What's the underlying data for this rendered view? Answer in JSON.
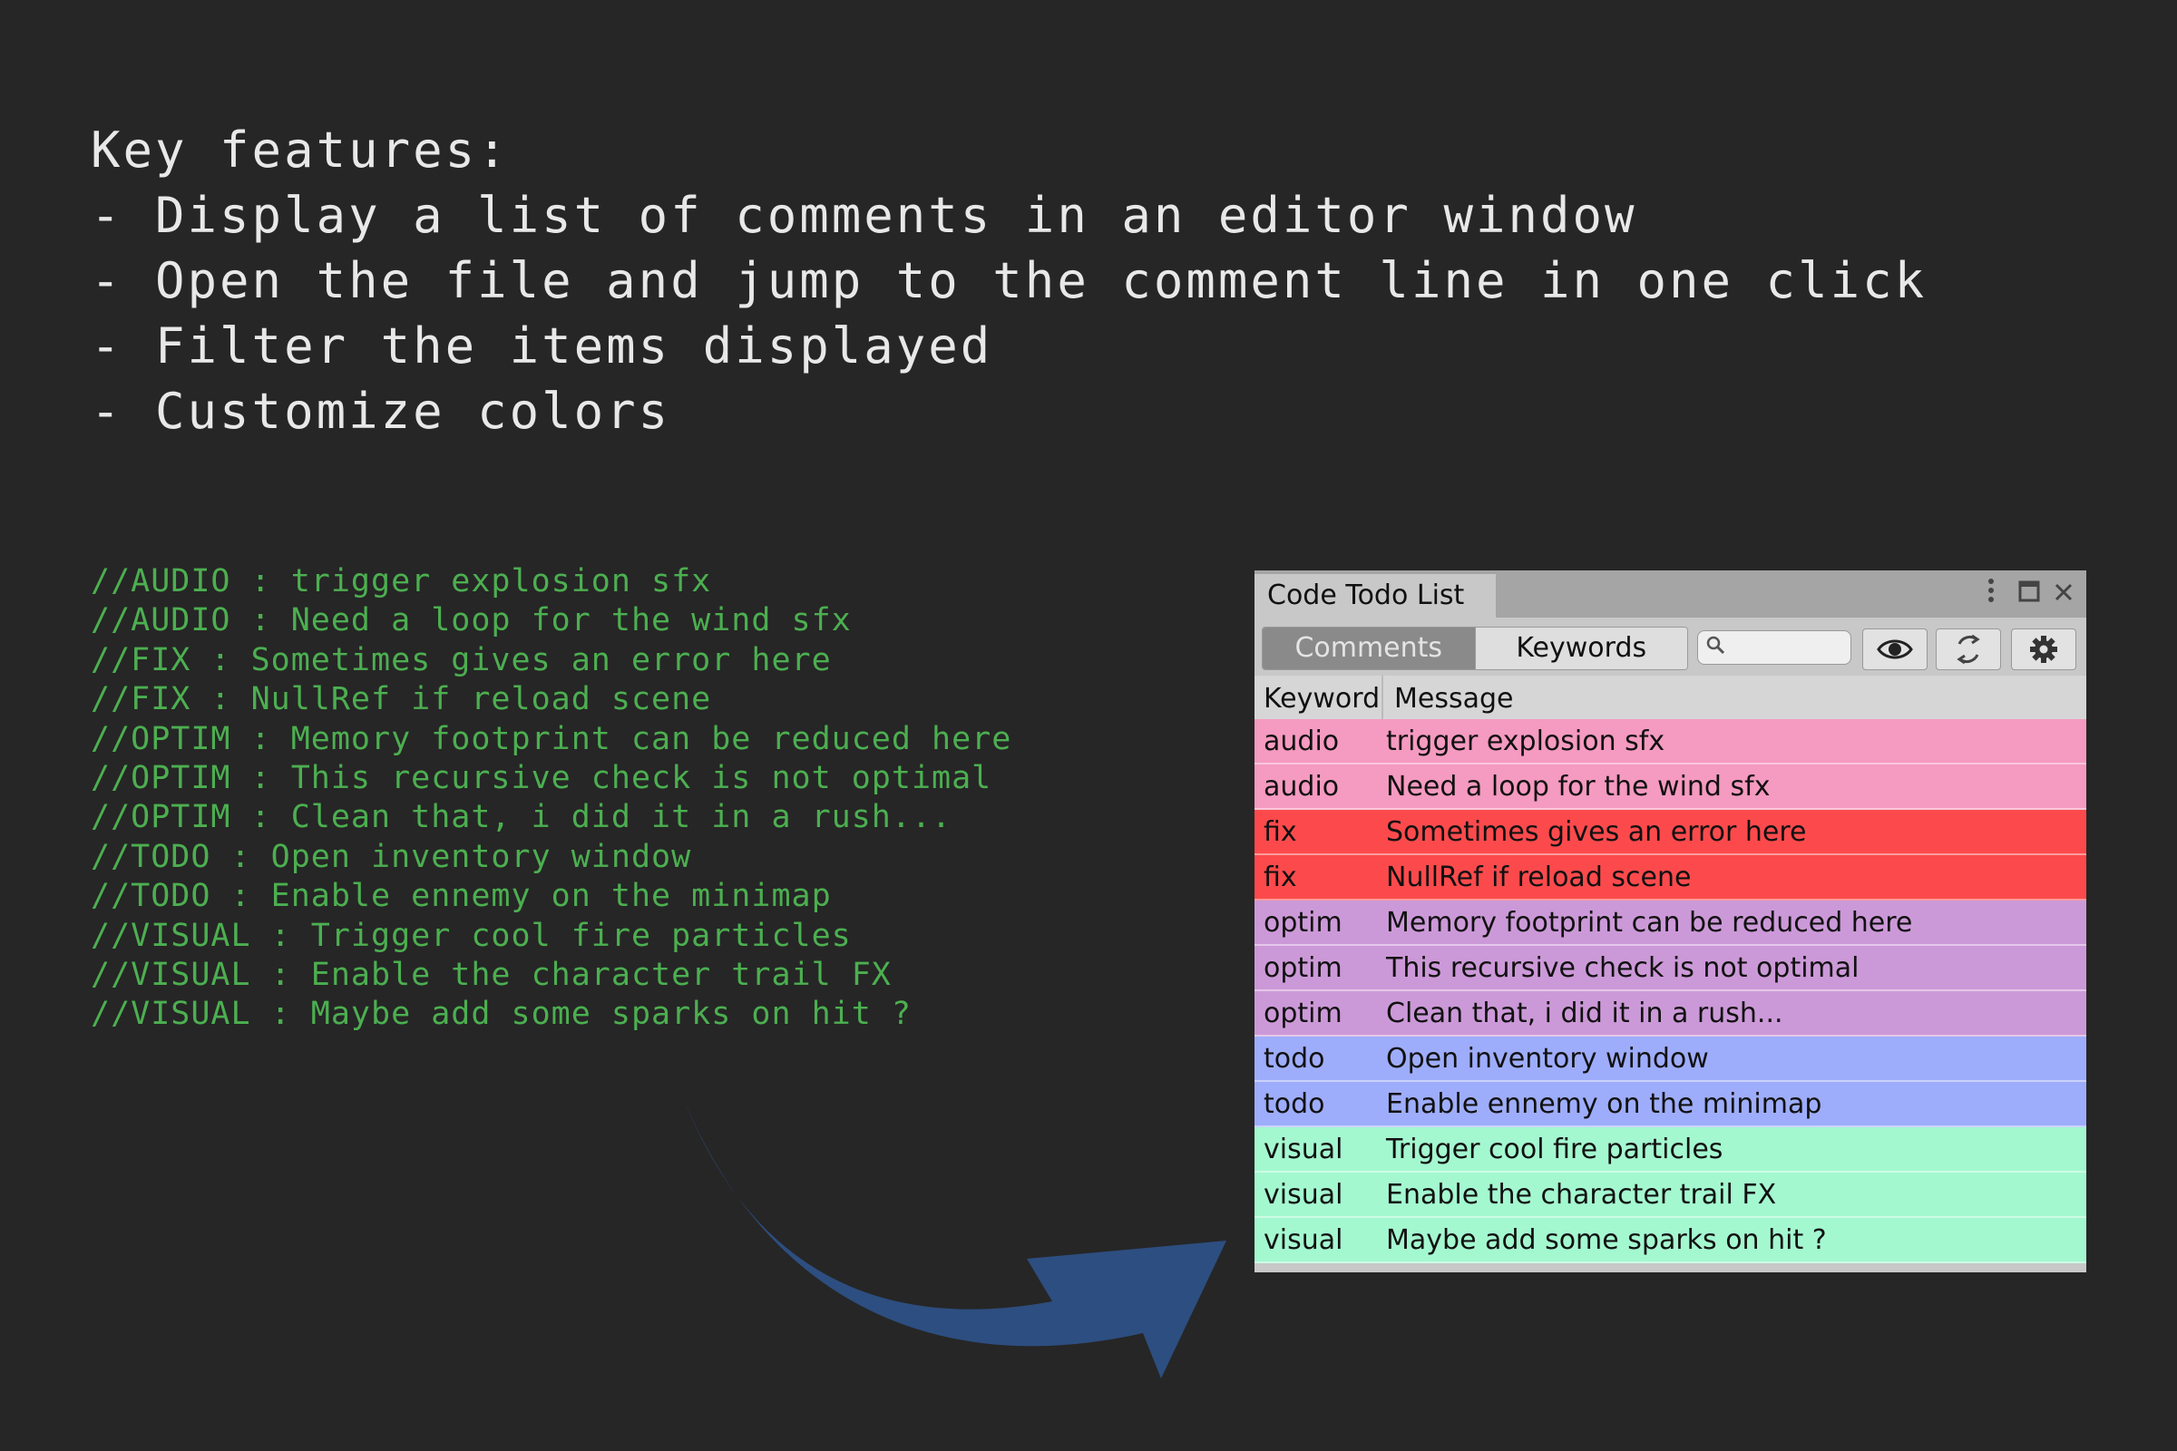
{
  "features": {
    "lines": [
      "Key features:",
      "- Display a list of comments in an editor window",
      "- Open the file and jump to the comment line in one click",
      "- Filter the items displayed",
      "- Customize colors"
    ]
  },
  "code_comments": [
    "//AUDIO : trigger explosion sfx",
    "//AUDIO : Need a loop for the wind sfx",
    "//FIX : Sometimes gives an error here",
    "//FIX : NullRef if reload scene",
    "//OPTIM : Memory footprint can be reduced here",
    "//OPTIM : This recursive check is not optimal",
    "//OPTIM : Clean that, i did it in a rush...",
    "//TODO : Open inventory window",
    "//TODO : Enable ennemy on the minimap",
    "//VISUAL : Trigger cool fire particles",
    "//VISUAL : Enable the character trail FX",
    "//VISUAL : Maybe add some sparks on hit ?"
  ],
  "window": {
    "title": "Code Todo List",
    "tabs": {
      "comments": "Comments",
      "keywords": "Keywords"
    },
    "search": {
      "value": "",
      "placeholder": ""
    },
    "icons": [
      "kebab-menu-icon",
      "maximize-icon",
      "close-icon",
      "search-icon",
      "eye-icon",
      "refresh-icon",
      "gear-icon"
    ],
    "columns": {
      "keyword": "Keyword",
      "message": "Message"
    },
    "rows": [
      {
        "keyword": "audio",
        "message": "trigger explosion sfx",
        "color": "#f59ac0"
      },
      {
        "keyword": "audio",
        "message": "Need a loop for the wind sfx",
        "color": "#f59ac0"
      },
      {
        "keyword": "fix",
        "message": "Sometimes gives an error here",
        "color": "#fc4a4c"
      },
      {
        "keyword": "fix",
        "message": "NullRef if reload scene",
        "color": "#fc4a4c"
      },
      {
        "keyword": "optim",
        "message": "Memory footprint can be reduced here",
        "color": "#cc99d8"
      },
      {
        "keyword": "optim",
        "message": "This recursive check is not optimal",
        "color": "#cc99d8"
      },
      {
        "keyword": "optim",
        "message": "Clean that, i did it in a rush...",
        "color": "#cc99d8"
      },
      {
        "keyword": "todo",
        "message": "Open inventory window",
        "color": "#9eadfb"
      },
      {
        "keyword": "todo",
        "message": "Enable ennemy on the minimap",
        "color": "#9eadfb"
      },
      {
        "keyword": "visual",
        "message": "Trigger cool fire particles",
        "color": "#a4f8d0"
      },
      {
        "keyword": "visual",
        "message": "Enable the character trail FX",
        "color": "#a4f8d0"
      },
      {
        "keyword": "visual",
        "message": "Maybe add some sparks on hit ?",
        "color": "#a4f8d0"
      }
    ]
  },
  "arrow": {
    "color": "#2d4e80"
  }
}
